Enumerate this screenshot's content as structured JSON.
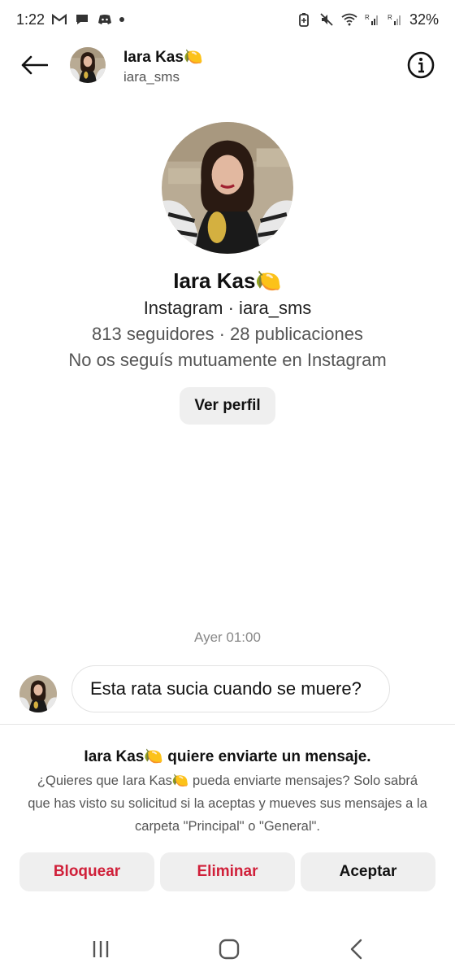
{
  "status_bar": {
    "time": "1:22",
    "battery": "32%",
    "left_icons": [
      "gmail-icon",
      "chat-icon",
      "discord-icon",
      "dot-icon"
    ],
    "right_icons": [
      "battery-saver-icon",
      "mute-icon",
      "wifi-icon",
      "signal-r-icon",
      "signal-r2-icon"
    ]
  },
  "header": {
    "name": "Iara Kas🍋",
    "username": "iara_sms"
  },
  "profile": {
    "name": "Iara Kas🍋",
    "source_line": "Instagram · iara_sms",
    "stats_line": "813 seguidores · 28 publicaciones",
    "mutual_line": "No os seguís mutuamente en Instagram",
    "view_profile_label": "Ver perfil"
  },
  "conversation": {
    "timestamp": "Ayer 01:00",
    "messages": [
      {
        "text": "Esta rata sucia cuando se muere?"
      }
    ]
  },
  "request": {
    "title_name": "Iara Kas🍋",
    "title_suffix": " quiere enviarte un mensaje.",
    "body": "¿Quieres que Iara Kas🍋 pueda enviarte mensajes? Solo sabrá que has visto su solicitud si la aceptas y mueves sus mensajes a la carpeta \"Principal\" o \"General\".",
    "buttons": {
      "block": "Bloquear",
      "delete": "Eliminar",
      "accept": "Aceptar"
    }
  },
  "colors": {
    "danger": "#d0203a",
    "button_bg": "#efefef",
    "muted_text": "#555555"
  }
}
